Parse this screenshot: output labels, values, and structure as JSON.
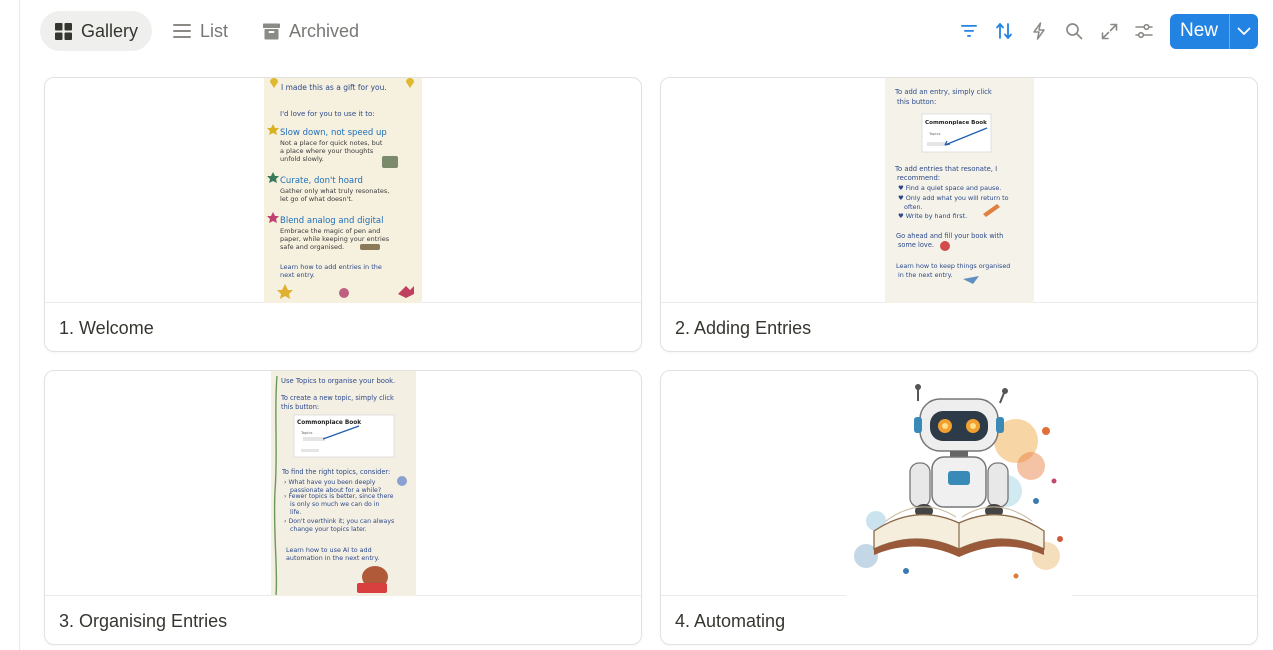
{
  "views": [
    {
      "label": "Gallery",
      "icon": "gallery-grid-icon",
      "active": true
    },
    {
      "label": "List",
      "icon": "list-lines-icon",
      "active": false
    },
    {
      "label": "Archived",
      "icon": "archive-box-icon",
      "active": false
    }
  ],
  "toolbar": {
    "tools": [
      "filter-icon",
      "sort-icon",
      "automation-bolt-icon",
      "search-icon",
      "expand-icon",
      "settings-sliders-icon"
    ],
    "new_label": "New"
  },
  "colors": {
    "accent": "#2383e2",
    "active_tab_bg": "#efefed"
  },
  "cards": [
    {
      "title": "1. Welcome",
      "cover": "handwritten-note-welcome",
      "note": {
        "heading": "I made this as a gift for you.",
        "intro": "I'd love for you to use it to:",
        "sections": [
          {
            "head": "Slow down, not speed up",
            "body": "Not a place for quick notes, but a place where your thoughts unfold slowly."
          },
          {
            "head": "Curate, don't hoard",
            "body": "Gather only what truly resonates, let go of what doesn't."
          },
          {
            "head": "Blend analog and digital",
            "body": "Embrace the magic of pen and paper, while keeping your entries safe and organised."
          }
        ],
        "footer": "Learn how to add entries in the next entry."
      }
    },
    {
      "title": "2. Adding Entries",
      "cover": "handwritten-note-adding",
      "note": {
        "heading": "To add an entry, simply click this button:",
        "screenshot_title": "Commonplace Book",
        "screenshot_item": "Topics",
        "intro": "To add entries that resonate, I recommend:",
        "bullets": [
          "Find a quiet space and pause.",
          "Only add what you will return to often.",
          "Write by hand first."
        ],
        "closing": "Go ahead and fill your book with some love.",
        "footer": "Learn how to keep things organised in the next entry."
      }
    },
    {
      "title": "3. Organising Entries",
      "cover": "handwritten-note-organising",
      "note": {
        "heading": "Use Topics to organise your book.",
        "sub": "To create a new topic, simply click this button:",
        "screenshot_title": "Commonplace Book",
        "screenshot_item": "Topics",
        "intro": "To find the right topics, consider:",
        "bullets": [
          "What have you been deeply passionate about for a while?",
          "Fewer topics is better, since there is only so much we can do in life.",
          "Don't overthink it; you can always change your topics later."
        ],
        "footer": "Learn how to use AI to add automation in the next entry."
      }
    },
    {
      "title": "4. Automating",
      "cover": "robot-reading-book-illustration"
    }
  ]
}
